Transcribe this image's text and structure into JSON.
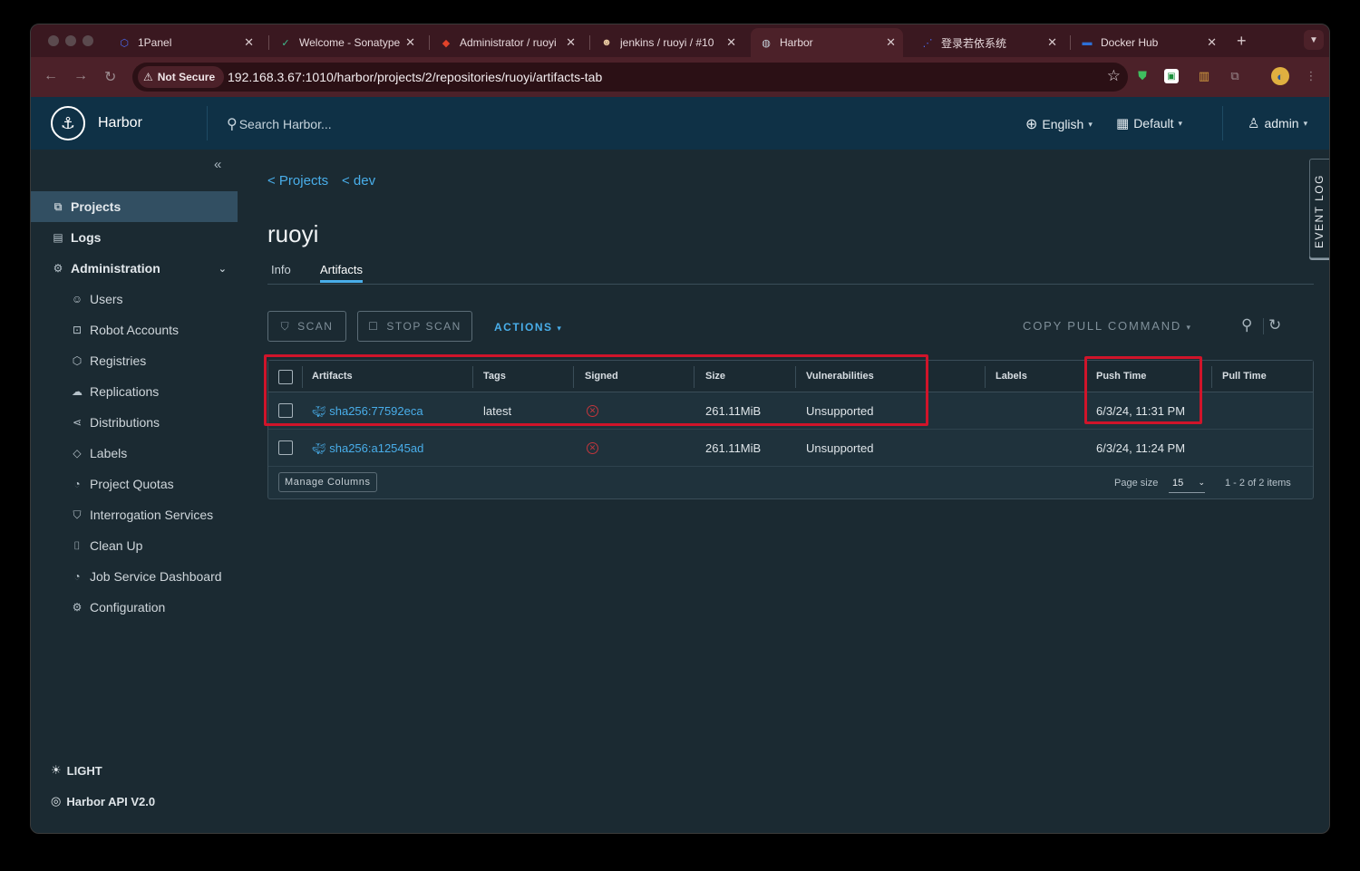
{
  "browser": {
    "tabs": [
      {
        "title": "1Panel",
        "icon": "shield-icon"
      },
      {
        "title": "Welcome - Sonatype",
        "icon": "sonatype-icon"
      },
      {
        "title": "Administrator / ruoyi",
        "icon": "gitlab-icon"
      },
      {
        "title": "jenkins / ruoyi / #10",
        "icon": "jenkins-icon"
      },
      {
        "title": "Harbor",
        "icon": "harbor-icon"
      },
      {
        "title": "登录若依系统",
        "icon": "ruoyi-icon"
      },
      {
        "title": "Docker Hub",
        "icon": "docker-icon"
      }
    ],
    "security_label": "Not Secure",
    "url": "192.168.3.67:1010/harbor/projects/2/repositories/ruoyi/artifacts-tab"
  },
  "header": {
    "brand": "Harbor",
    "search_placeholder": "Search Harbor...",
    "language": "English",
    "datetime_format": "Default",
    "user": "admin"
  },
  "sidebar": {
    "items": [
      {
        "label": "Projects"
      },
      {
        "label": "Logs"
      },
      {
        "label": "Administration"
      }
    ],
    "admin_items": [
      {
        "label": "Users"
      },
      {
        "label": "Robot Accounts"
      },
      {
        "label": "Registries"
      },
      {
        "label": "Replications"
      },
      {
        "label": "Distributions"
      },
      {
        "label": "Labels"
      },
      {
        "label": "Project Quotas"
      },
      {
        "label": "Interrogation Services"
      },
      {
        "label": "Clean Up"
      },
      {
        "label": "Job Service Dashboard"
      },
      {
        "label": "Configuration"
      }
    ],
    "theme": "LIGHT",
    "api": "Harbor API V2.0"
  },
  "main": {
    "breadcrumb": [
      "< Projects",
      "< dev"
    ],
    "title": "ruoyi",
    "tabs": [
      "Info",
      "Artifacts"
    ],
    "toolbar": {
      "scan": "SCAN",
      "stop_scan": "STOP SCAN",
      "actions": "ACTIONS",
      "copy_pull": "COPY PULL COMMAND"
    },
    "columns": [
      "Artifacts",
      "Tags",
      "Signed",
      "Size",
      "Vulnerabilities",
      "Labels",
      "Push Time",
      "Pull Time"
    ],
    "rows": [
      {
        "artifact": "sha256:77592eca",
        "tag": "latest",
        "size": "261.11MiB",
        "vulnerabilities": "Unsupported",
        "push_time": "6/3/24, 11:31 PM"
      },
      {
        "artifact": "sha256:a12545ad",
        "tag": "",
        "size": "261.11MiB",
        "vulnerabilities": "Unsupported",
        "push_time": "6/3/24, 11:24 PM"
      }
    ],
    "footer": {
      "manage_columns": "Manage Columns",
      "page_size_label": "Page size",
      "page_size": "15",
      "page_info": "1 - 2 of 2 items"
    }
  },
  "event_log": "EVENT LOG",
  "colors": {
    "accent": "#49aeea",
    "highlight_box": "#d0142a",
    "header_bg": "#0f3146",
    "tab_strip": "#3a1820"
  }
}
